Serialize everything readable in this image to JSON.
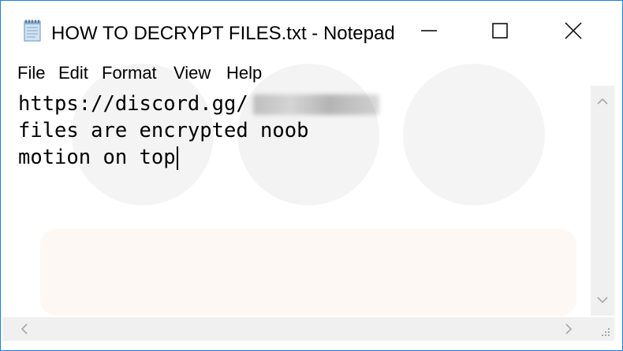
{
  "window": {
    "title": "HOW TO DECRYPT FILES.txt - Notepad",
    "app_icon": "notepad-icon",
    "controls": [
      "minimize-icon",
      "maximize-icon",
      "close-icon"
    ]
  },
  "menu": {
    "items": [
      "File",
      "Edit",
      "Format",
      "View",
      "Help"
    ]
  },
  "editor": {
    "lines": [
      "https://discord.gg/",
      "files are encrypted noob",
      "motion on top"
    ]
  },
  "colors": {
    "border": "#1883d7",
    "scrollbar": "#f0f0f0",
    "arrow": "#a6a6a6"
  }
}
